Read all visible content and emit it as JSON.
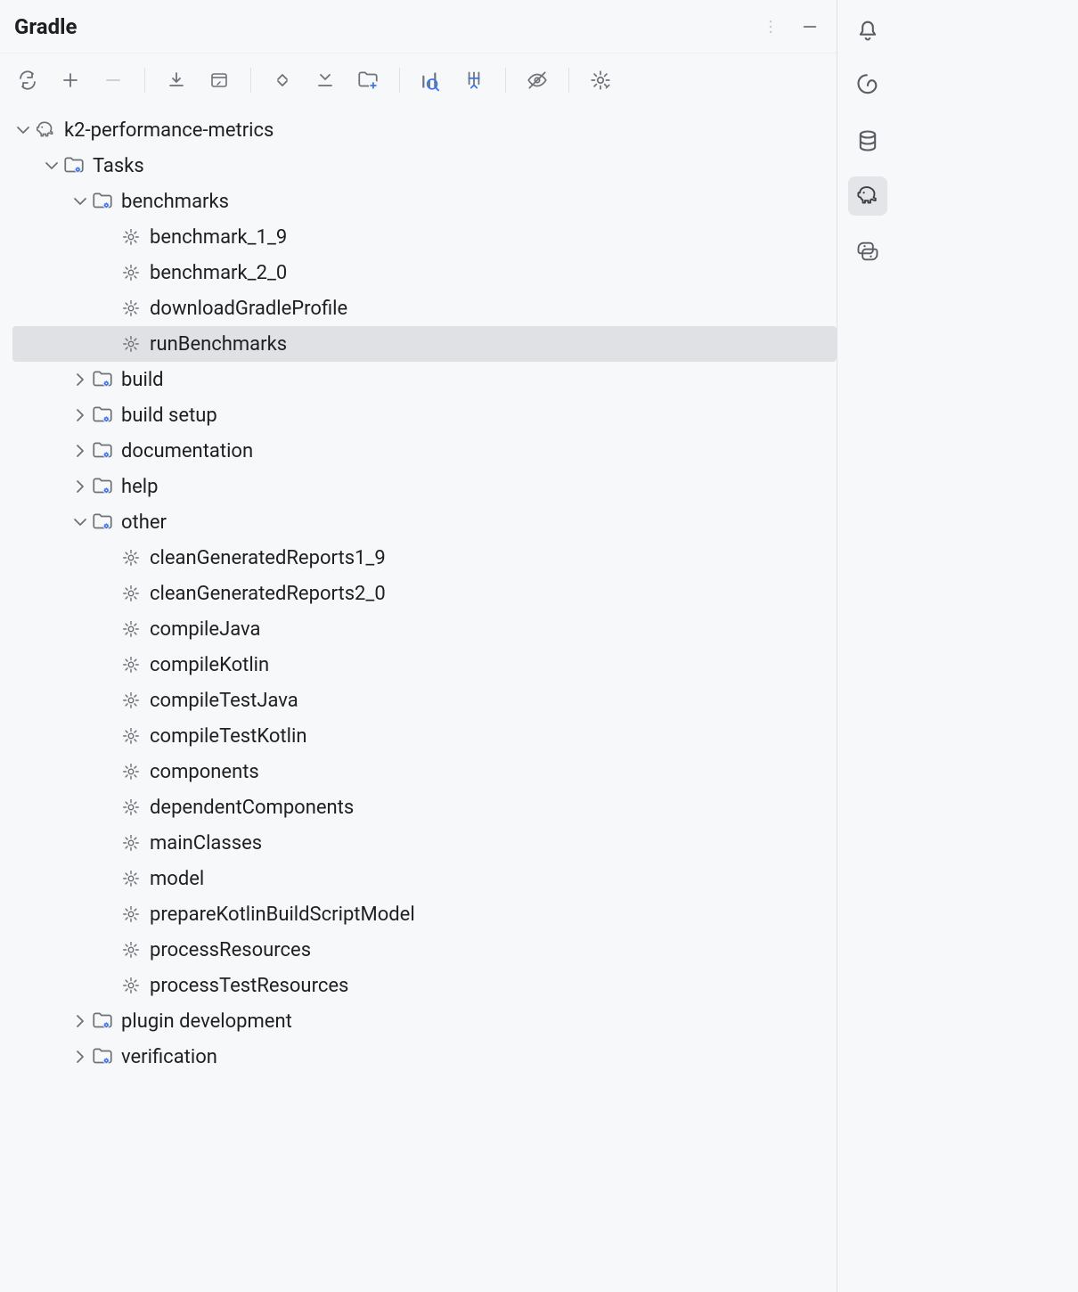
{
  "panel": {
    "title": "Gradle"
  },
  "tree": {
    "root": {
      "label": "k2-performance-metrics",
      "expanded": true,
      "tasks": {
        "label": "Tasks",
        "expanded": true,
        "groups": {
          "benchmarks": {
            "label": "benchmarks",
            "expanded": true,
            "tasks": [
              {
                "label": "benchmark_1_9",
                "selected": false
              },
              {
                "label": "benchmark_2_0",
                "selected": false
              },
              {
                "label": "downloadGradleProfile",
                "selected": false
              },
              {
                "label": "runBenchmarks",
                "selected": true
              }
            ]
          },
          "build": {
            "label": "build",
            "expanded": false
          },
          "build_setup": {
            "label": "build setup",
            "expanded": false
          },
          "documentation": {
            "label": "documentation",
            "expanded": false
          },
          "help": {
            "label": "help",
            "expanded": false
          },
          "other": {
            "label": "other",
            "expanded": true,
            "tasks": [
              {
                "label": "cleanGeneratedReports1_9"
              },
              {
                "label": "cleanGeneratedReports2_0"
              },
              {
                "label": "compileJava"
              },
              {
                "label": "compileKotlin"
              },
              {
                "label": "compileTestJava"
              },
              {
                "label": "compileTestKotlin"
              },
              {
                "label": "components"
              },
              {
                "label": "dependentComponents"
              },
              {
                "label": "mainClasses"
              },
              {
                "label": "model"
              },
              {
                "label": "prepareKotlinBuildScriptModel"
              },
              {
                "label": "processResources"
              },
              {
                "label": "processTestResources"
              }
            ]
          },
          "plugin_development": {
            "label": "plugin development",
            "expanded": false
          },
          "verification": {
            "label": "verification",
            "expanded": false
          }
        }
      }
    }
  }
}
